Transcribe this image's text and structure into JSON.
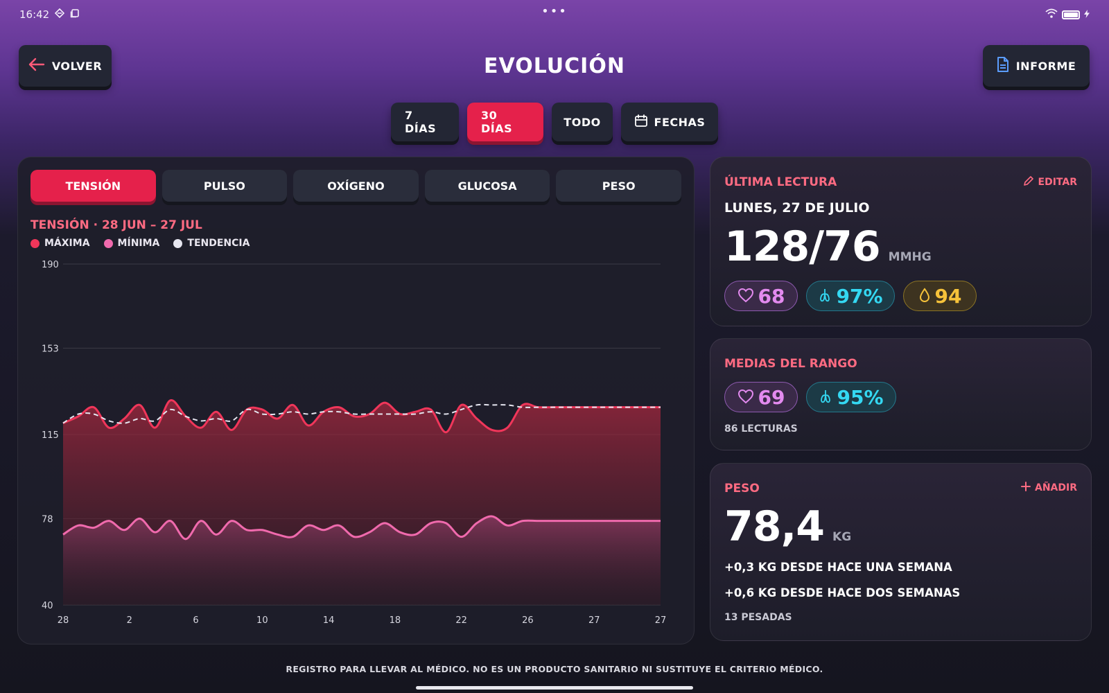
{
  "status_bar": {
    "time": "16:42",
    "center": "•••"
  },
  "header": {
    "back_label": "VOLVER",
    "title": "EVOLUCIÓN",
    "report_label": "INFORME"
  },
  "range_tabs": [
    {
      "label": "7 DÍAS",
      "active": false
    },
    {
      "label": "30 DÍAS",
      "active": true
    },
    {
      "label": "TODO",
      "active": false
    },
    {
      "label": "FECHAS",
      "active": false
    }
  ],
  "metric_tabs": [
    {
      "label": "TENSIÓN",
      "active": true
    },
    {
      "label": "PULSO",
      "active": false
    },
    {
      "label": "OXÍGENO",
      "active": false
    },
    {
      "label": "GLUCOSA",
      "active": false
    },
    {
      "label": "PESO",
      "active": false
    }
  ],
  "chart": {
    "title": "TENSIÓN · 28 JUN – 27 JUL",
    "legend": [
      {
        "label": "MÁXIMA",
        "color": "#f0365a"
      },
      {
        "label": "MÍNIMA",
        "color": "#f06aad"
      },
      {
        "label": "TENDENCIA",
        "color": "#e6e6f0"
      }
    ]
  },
  "chart_data": {
    "type": "area",
    "title": "TENSIÓN · 28 JUN – 27 JUL",
    "x_tick_labels": [
      "28",
      "2",
      "6",
      "10",
      "14",
      "18",
      "22",
      "26",
      "27",
      "27"
    ],
    "y_ticks": [
      40,
      78,
      115,
      153,
      190
    ],
    "ylim": [
      40,
      190
    ],
    "grid": true,
    "series": [
      {
        "name": "MÁXIMA",
        "color": "#f0365a",
        "values": [
          120,
          123,
          127,
          118,
          122,
          128,
          118,
          130,
          123,
          118,
          125,
          117,
          126,
          126,
          122,
          128,
          119,
          125,
          127,
          123,
          124,
          129,
          124,
          125,
          126,
          116,
          128,
          122,
          117,
          118,
          128,
          127,
          127,
          127,
          127,
          127,
          127,
          127,
          127,
          127
        ]
      },
      {
        "name": "MÍNIMA",
        "color": "#f06aad",
        "values": [
          71,
          75,
          74,
          77,
          73,
          78,
          72,
          77,
          69,
          77,
          71,
          77,
          73,
          73,
          71,
          70,
          75,
          73,
          75,
          70,
          72,
          76,
          72,
          71,
          76,
          76,
          70,
          76,
          79,
          75,
          77,
          77,
          77,
          77,
          77,
          77,
          77,
          77,
          77,
          77
        ]
      },
      {
        "name": "TENDENCIA",
        "color": "#e6e6f0",
        "values": [
          120,
          124,
          124,
          121,
          120,
          122,
          121,
          126,
          123,
          121,
          122,
          121,
          126,
          124,
          124,
          125,
          124,
          125,
          125,
          124,
          124,
          124,
          124,
          124,
          125,
          124,
          126,
          128,
          128,
          128,
          127,
          127,
          127,
          127,
          127,
          127,
          127,
          127,
          127,
          127
        ]
      }
    ]
  },
  "last_reading": {
    "label": "ÚLTIMA LECTURA",
    "edit_label": "EDITAR",
    "date": "LUNES, 27 DE JULIO",
    "value": "128/76",
    "unit": "MMHG",
    "pulse": "68",
    "oxygen": "97%",
    "glucose": "94"
  },
  "range_averages": {
    "label": "MEDIAS DEL RANGO",
    "pulse": "69",
    "oxygen": "95%",
    "count": "86 LECTURAS"
  },
  "weight": {
    "label": "PESO",
    "add_label": "AÑADIR",
    "value": "78,4",
    "unit": "KG",
    "change_week": "+0,3 KG DESDE HACE UNA SEMANA",
    "change_two_weeks": "+0,6 KG DESDE HACE DOS SEMANAS",
    "count": "13 PESADAS"
  },
  "footer": {
    "note": "REGISTRO PARA LLEVAR AL MÉDICO. NO ES UN PRODUCTO SANITARIO NI SUSTITUYE EL CRITERIO MÉDICO."
  }
}
